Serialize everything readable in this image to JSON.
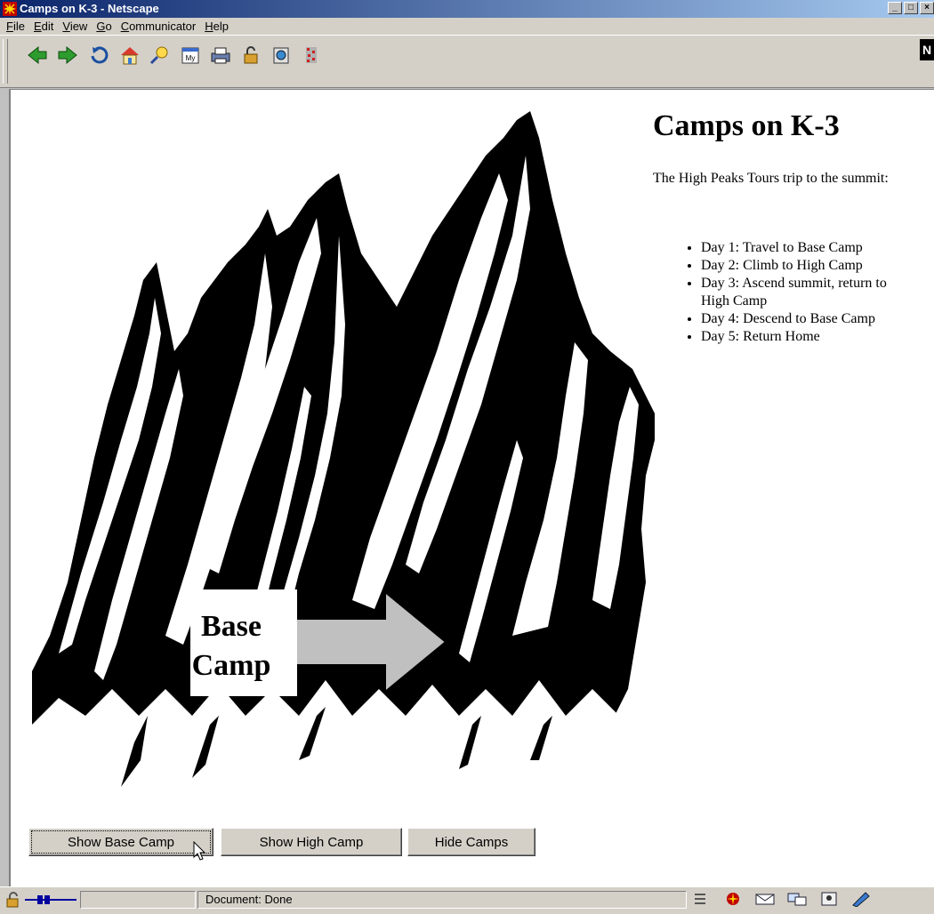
{
  "window": {
    "title": "Camps on K-3 - Netscape"
  },
  "menubar": {
    "items": [
      {
        "label": "File",
        "underline": "F",
        "rest": "ile"
      },
      {
        "label": "Edit",
        "underline": "E",
        "rest": "dit"
      },
      {
        "label": "View",
        "underline": "V",
        "rest": "iew"
      },
      {
        "label": "Go",
        "underline": "G",
        "rest": "o"
      },
      {
        "label": "Communicator",
        "underline": "C",
        "rest": "ommunicator"
      },
      {
        "label": "Help",
        "underline": "H",
        "rest": "elp"
      }
    ]
  },
  "toolbar": {
    "icons": [
      "back-icon",
      "forward-icon",
      "reload-icon",
      "home-icon",
      "search-icon",
      "my-netscape-icon",
      "print-icon",
      "security-icon",
      "shop-icon",
      "stop-icon"
    ],
    "logo": "N"
  },
  "page": {
    "heading": "Camps on K-3",
    "intro": "The High Peaks Tours trip to the summit:",
    "days": [
      "Day 1: Travel to Base Camp",
      "Day 2: Climb to High Camp",
      "Day 3: Ascend summit, return to High Camp",
      "Day 4: Descend to Base Camp",
      "Day 5: Return Home"
    ],
    "camp_label_line1": "Base",
    "camp_label_line2": "Camp",
    "buttons": {
      "show_base": "Show Base Camp",
      "show_high": "Show High Camp",
      "hide": "Hide Camps"
    }
  },
  "statusbar": {
    "status": "Document: Done"
  },
  "colors": {
    "titlebar_start": "#0a246a",
    "titlebar_end": "#a6caf0",
    "chrome": "#d4d0c8",
    "arrow": "#c0c0c0"
  }
}
